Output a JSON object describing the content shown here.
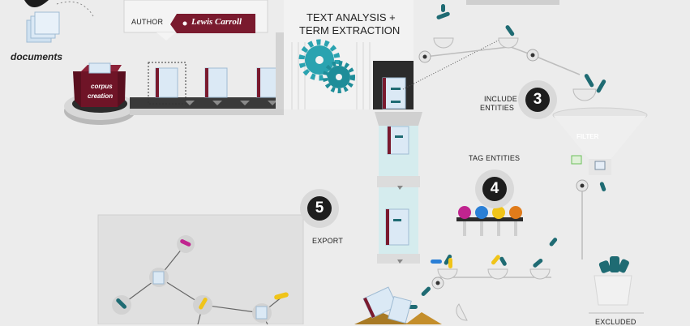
{
  "labels": {
    "documents": "documents",
    "author_key": "AUTHOR",
    "author_value": "Lewis Carroll",
    "corpus_line1": "corpus",
    "corpus_line2": "creation",
    "text_analysis_line1": "TEXT ANALYSIS +",
    "text_analysis_line2": "TERM EXTRACTION",
    "include_line1": "INCLUDE",
    "include_line2": "ENTITIES",
    "filter": "FILTER",
    "tag_entities": "TAG ENTITIES",
    "export": "EXPORT",
    "excluded": "EXCLUDED"
  },
  "steps": {
    "three": "3",
    "four": "4",
    "five": "5"
  },
  "colors": {
    "background": "#ececec",
    "burgundy": "#7a1a2e",
    "teal": "#1f6b73",
    "gear": "#2aa3b0",
    "magenta": "#c0248f",
    "yellow": "#f0c419",
    "blue": "#2a7fd6",
    "orange": "#e07b1a",
    "dark": "#1d1d1d"
  }
}
